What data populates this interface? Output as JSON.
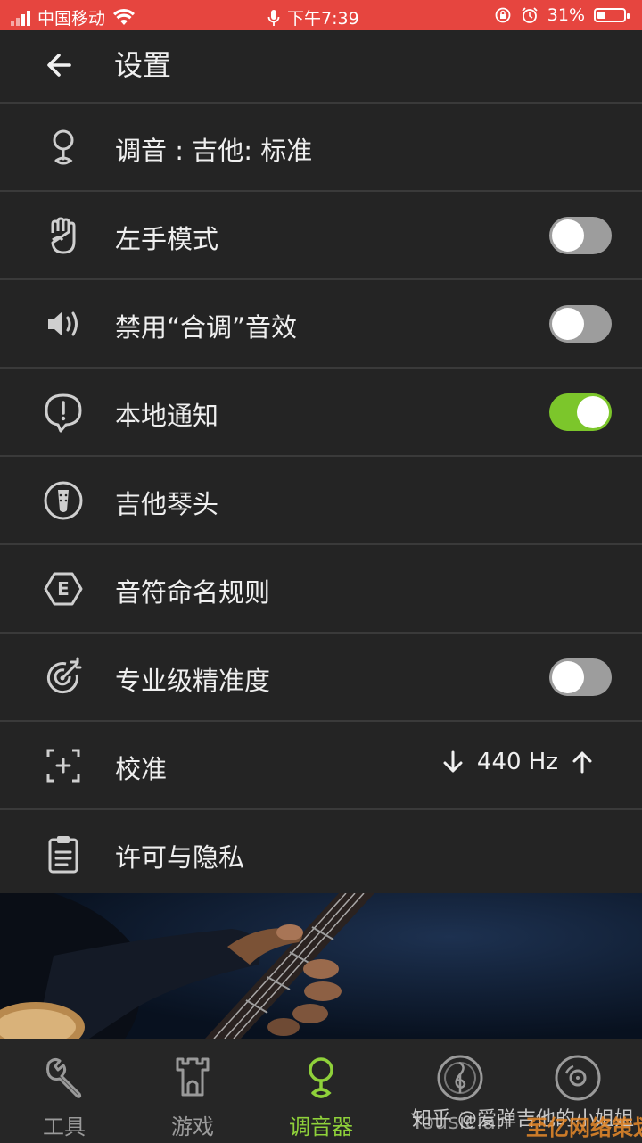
{
  "status_bar": {
    "carrier": "中国移动",
    "time": "下午7:39",
    "battery_pct": "31%",
    "battery_level": 0.31,
    "accent": "#e6453f"
  },
  "header": {
    "title": "设置"
  },
  "settings": [
    {
      "icon": "tuner-pin-icon",
      "label": "调音 : 吉他: 标准",
      "control": "none"
    },
    {
      "icon": "hand-icon",
      "label": "左手模式",
      "control": "toggle",
      "on": false
    },
    {
      "icon": "speaker-icon",
      "label": "禁用“合调”音效",
      "control": "toggle",
      "on": false
    },
    {
      "icon": "notification-icon",
      "label": "本地通知",
      "control": "toggle",
      "on": true
    },
    {
      "icon": "guitar-head-icon",
      "label": "吉他琴头",
      "control": "none"
    },
    {
      "icon": "note-naming-icon",
      "label": "音符命名规则",
      "control": "none"
    },
    {
      "icon": "target-icon",
      "label": "专业级精准度",
      "control": "toggle",
      "on": false
    },
    {
      "icon": "calibrate-icon",
      "label": "校准",
      "control": "calibration",
      "value": "440 Hz"
    },
    {
      "icon": "clipboard-icon",
      "label": "许可与隐私",
      "control": "none"
    }
  ],
  "bottom_nav": [
    {
      "icon": "wrench-icon",
      "label": "工具",
      "active": false
    },
    {
      "icon": "castle-icon",
      "label": "游戏",
      "active": false
    },
    {
      "icon": "tuner-icon",
      "label": "调音器",
      "active": true
    },
    {
      "icon": "yousician-icon",
      "label": "Yousician",
      "active": false
    },
    {
      "icon": "disc-icon",
      "label": "",
      "active": false
    }
  ],
  "watermark": "知乎 @爱弹吉他的小姐姐",
  "watermark2": "至亿网络策划",
  "colors": {
    "toggle_on": "#7cc62b",
    "active_tab": "#8fd13a",
    "background": "#242424"
  }
}
